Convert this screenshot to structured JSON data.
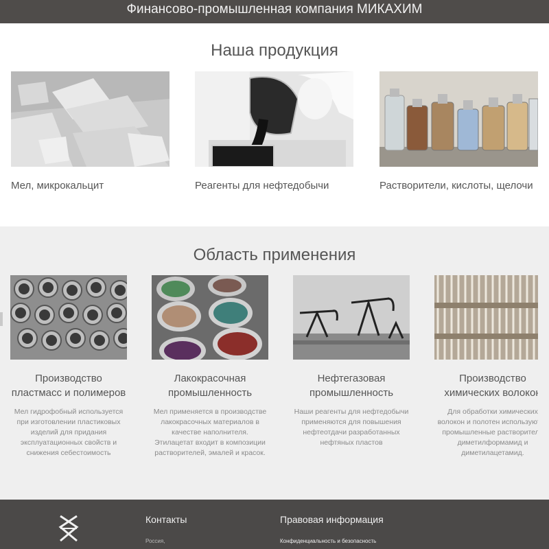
{
  "header": {
    "title": "Финансово-промышленная компания МИКАХИМ"
  },
  "products": {
    "title": "Наша продукция",
    "items": [
      {
        "label": "Мел, микрокальцит",
        "image": "chalk-image"
      },
      {
        "label": "Реагенты для нефтедобычи",
        "image": "oil-reagent-pour-image"
      },
      {
        "label": "Растворители, кислоты, щелочи",
        "image": "chemical-bottles-image"
      }
    ]
  },
  "applications": {
    "title": "Область применения",
    "items": [
      {
        "title": "Производство пластмасс и полимеров",
        "desc": "Мел гидрофобный используется при изготовлении пластиковых изделий для придания эксплуатационных свойств и снижения себестоимость",
        "image": "plastic-pipes-image"
      },
      {
        "title": "Лакокрасочная промышленность",
        "desc": "Мел применяется в производстве лакокрасочных материалов в качестве наполнителя. Этилацетат входит в композиции растворителей, эмалей и красок.",
        "image": "paint-cans-image"
      },
      {
        "title": "Нефтегазовая промышленность",
        "desc": "Наши реагенты для нефтедобычи применяются для повышения нефтеотдачи разработанных нефтяных пластов",
        "image": "oil-pumps-image"
      },
      {
        "title": "Производство химических волокон",
        "desc": "Для обработки химических волокон и полотен используются промышленные растворители диметилформамид и диметилацетамид.",
        "image": "chemical-fibers-image"
      }
    ]
  },
  "footer": {
    "contacts_title": "Контакты",
    "contacts_line": "Россия,",
    "legal_title": "Правовая информация",
    "legal_link": "Конфиденциальность и безопасность"
  }
}
